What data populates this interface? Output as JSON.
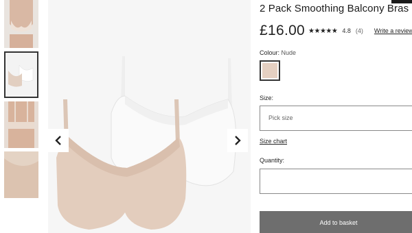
{
  "product": {
    "title": "2 Pack Smoothing Balcony Bras",
    "price": "£16.00",
    "stars": "★★★★★",
    "rating": "4.8",
    "review_count": "(4)",
    "write_review": "Write a review"
  },
  "colour": {
    "label": "Colour:",
    "value": "Nude",
    "swatch_color": "#e5d0c2"
  },
  "size": {
    "label": "Size:",
    "placeholder": "Pick size",
    "chart_link": "Size chart"
  },
  "quantity": {
    "label": "Quantity:"
  },
  "actions": {
    "add_to_basket": "Add to basket"
  },
  "gallery": {
    "prev_icon": "chevron-left-icon",
    "next_icon": "chevron-right-icon",
    "selected_thumbnail": 2
  },
  "colors": {
    "button_grey": "#6e6e6e",
    "nude": "#e5d0c2",
    "white_bra": "#f4f4f4"
  }
}
